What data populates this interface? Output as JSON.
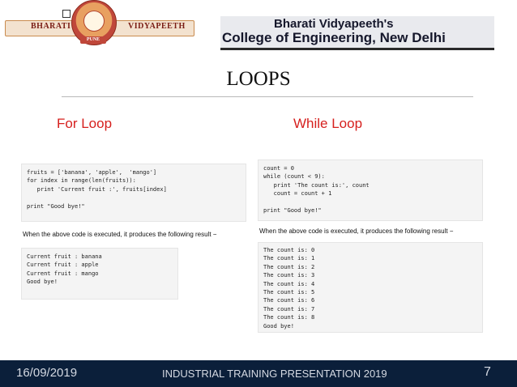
{
  "header": {
    "logo_left_text": "BHARATI",
    "logo_right_text": "VIDYAPEETH",
    "logo_city": "PUNE",
    "institution_line1": "Bharati Vidyapeeth's",
    "institution_line2": "College of Engineering, New Delhi"
  },
  "slide": {
    "title": "LOOPS",
    "left_heading": "For Loop",
    "right_heading": "While Loop"
  },
  "for_loop": {
    "code_lines": [
      "fruits = ['banana', 'apple',  'mango']",
      "for index in range(len(fruits)):",
      "   print 'Current fruit :', fruits[index]",
      "",
      "print \"Good bye!\""
    ],
    "result_note": "When the above code is executed, it produces the following result −",
    "output_lines": [
      "Current fruit : banana",
      "Current fruit : apple",
      "Current fruit : mango",
      "Good bye!"
    ]
  },
  "while_loop": {
    "code_lines": [
      "count = 0",
      "while (count < 9):",
      "   print 'The count is:', count",
      "   count = count + 1",
      "",
      "print \"Good bye!\""
    ],
    "result_note": "When the above code is executed, it produces the following result −",
    "output_lines": [
      "The count is: 0",
      "The count is: 1",
      "The count is: 2",
      "The count is: 3",
      "The count is: 4",
      "The count is: 5",
      "The count is: 6",
      "The count is: 7",
      "The count is: 8",
      "Good bye!"
    ]
  },
  "footer": {
    "date": "16/09/2019",
    "center_text": "INDUSTRIAL TRAINING PRESENTATION 2019",
    "page_number": "7"
  },
  "colors": {
    "heading_red": "#d6201e",
    "footer_navy": "#0b1f3a",
    "code_bg": "#f4f4f4"
  }
}
